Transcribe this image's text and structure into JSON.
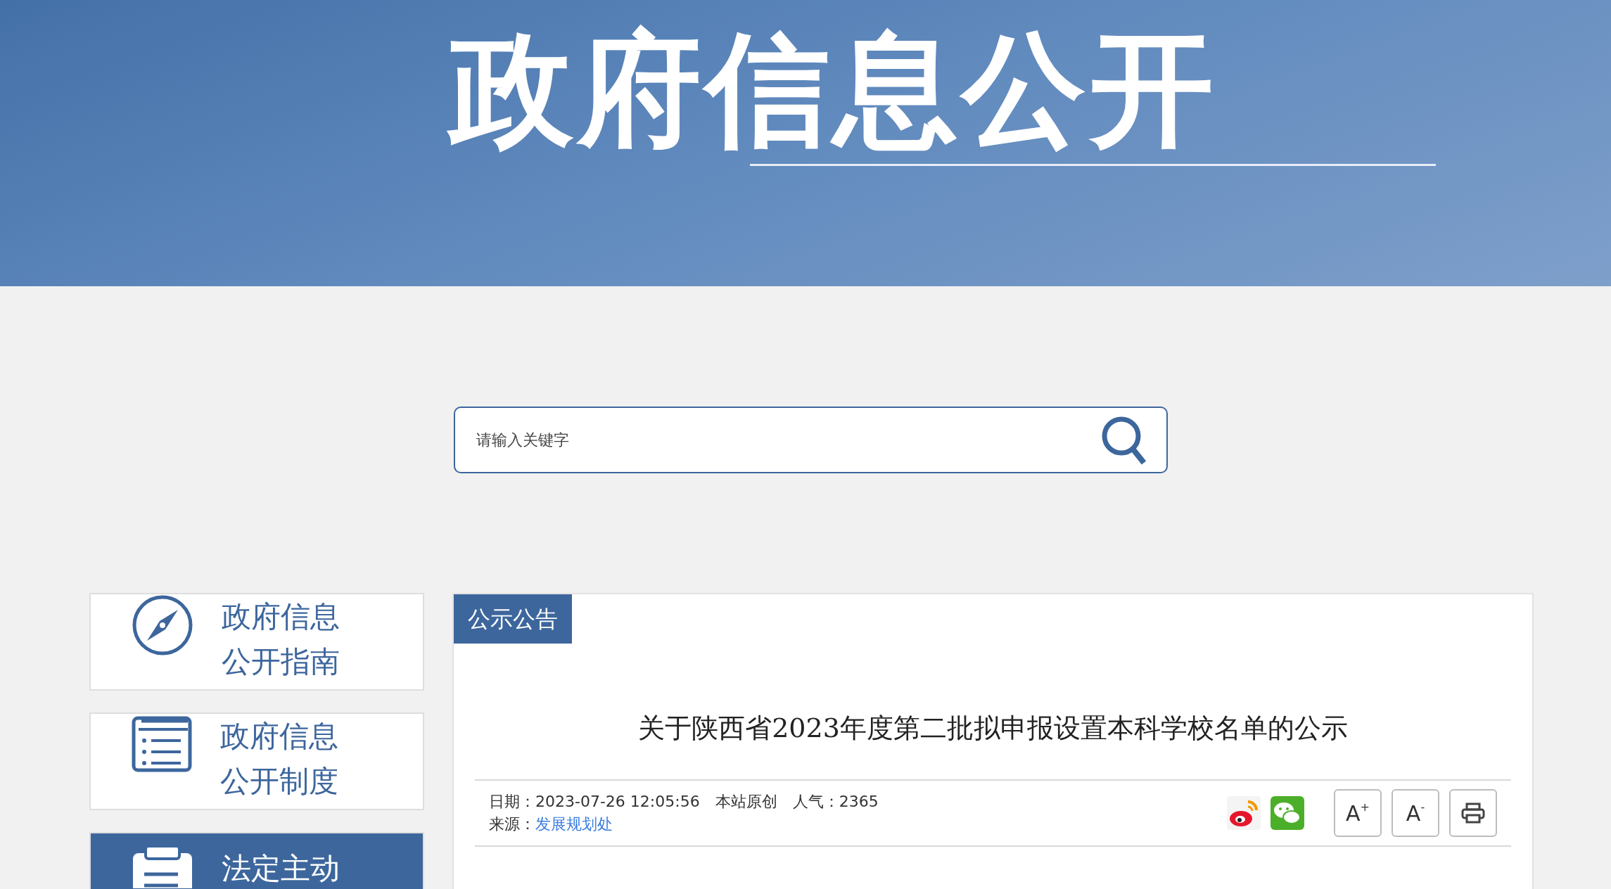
{
  "banner": {
    "title": "政府信息公开"
  },
  "search": {
    "placeholder": "请输入关键字"
  },
  "sidebar": {
    "items": [
      {
        "kind": "compass",
        "lines": [
          "政府信息",
          "公开指南"
        ],
        "selected": false
      },
      {
        "kind": "list",
        "lines": [
          "政府信息",
          "公开制度"
        ],
        "selected": false
      },
      {
        "kind": "clipboard",
        "lines": [
          "法定主动"
        ],
        "selected": true
      }
    ]
  },
  "panel": {
    "tab": "公示公告",
    "article": {
      "title": "关于陕西省2023年度第二批拟申报设置本科学校名单的公示",
      "date_label": "日期：",
      "date": "2023-07-26 12:05:56",
      "origin": "本站原创",
      "views_label": "人气：",
      "views": "2365",
      "source_label": "来源：",
      "source": "发展规划处"
    },
    "share": [
      {
        "kind": "weibo"
      },
      {
        "kind": "wechat"
      }
    ],
    "tools": [
      {
        "kind": "text",
        "label": "A",
        "mark": "+"
      },
      {
        "kind": "text",
        "label": "A",
        "mark": "-"
      },
      {
        "kind": "print"
      }
    ]
  }
}
